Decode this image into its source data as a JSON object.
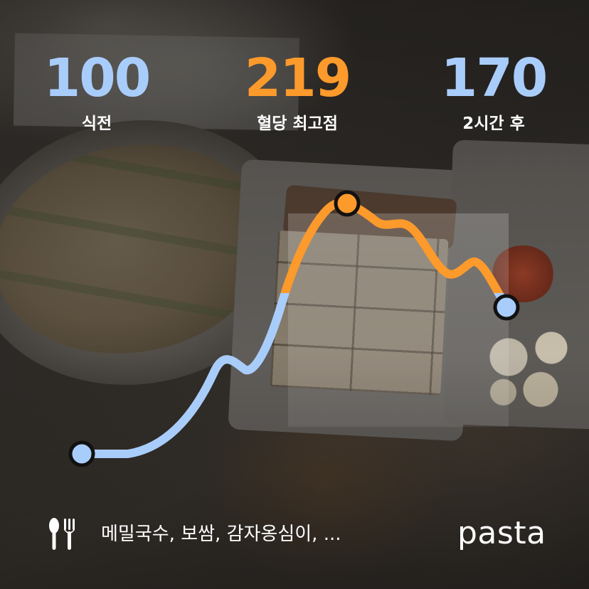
{
  "stats": {
    "before": {
      "value": "100",
      "label": "식전"
    },
    "peak": {
      "value": "219",
      "label": "혈당 최고점"
    },
    "after": {
      "value": "170",
      "label": "2시간 후"
    }
  },
  "footer": {
    "icon": "utensils-icon",
    "foods": "메밀국수, 보쌈, 감자옹심이, ...",
    "brand": "pasta"
  },
  "colors": {
    "blue": "#a9cdfb",
    "orange": "#fc9a2c",
    "outline": "#111111"
  }
}
